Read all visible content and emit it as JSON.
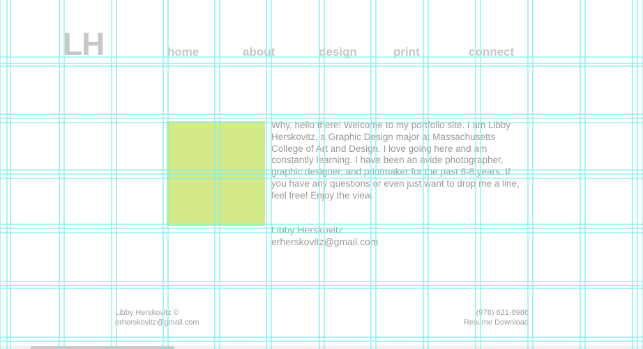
{
  "logo": "LH",
  "nav": [
    {
      "label": "home"
    },
    {
      "label": "about"
    },
    {
      "label": "design"
    },
    {
      "label": "print"
    },
    {
      "label": "connect"
    }
  ],
  "intro": "Why, hello there! Welcome to my portfolio site. I am Libby Herskovitz, a Graphic Design major at Massachusetts College of Art and Design. I love going here and am constantly learning. I have been an avide photographer, graphic designer, and printmaker for the past 6-8 years. If you have any questions or even just want to drop me a line, feel free! Enjoy the view.",
  "signature": {
    "name": "Libby Herskovitz",
    "email": "erherskovitz@gmail.com"
  },
  "footer": {
    "copyright": "Libby Herskovitz ©",
    "email": "erherskovitz@gmail.com",
    "phone": "(978) 621-8986",
    "resume": "Resume Download"
  },
  "colors": {
    "grid": "#7ff0ef",
    "photo_placeholder": "#d4ea8a",
    "text": "#9a9a9a",
    "nav": "#c8c8c8"
  }
}
